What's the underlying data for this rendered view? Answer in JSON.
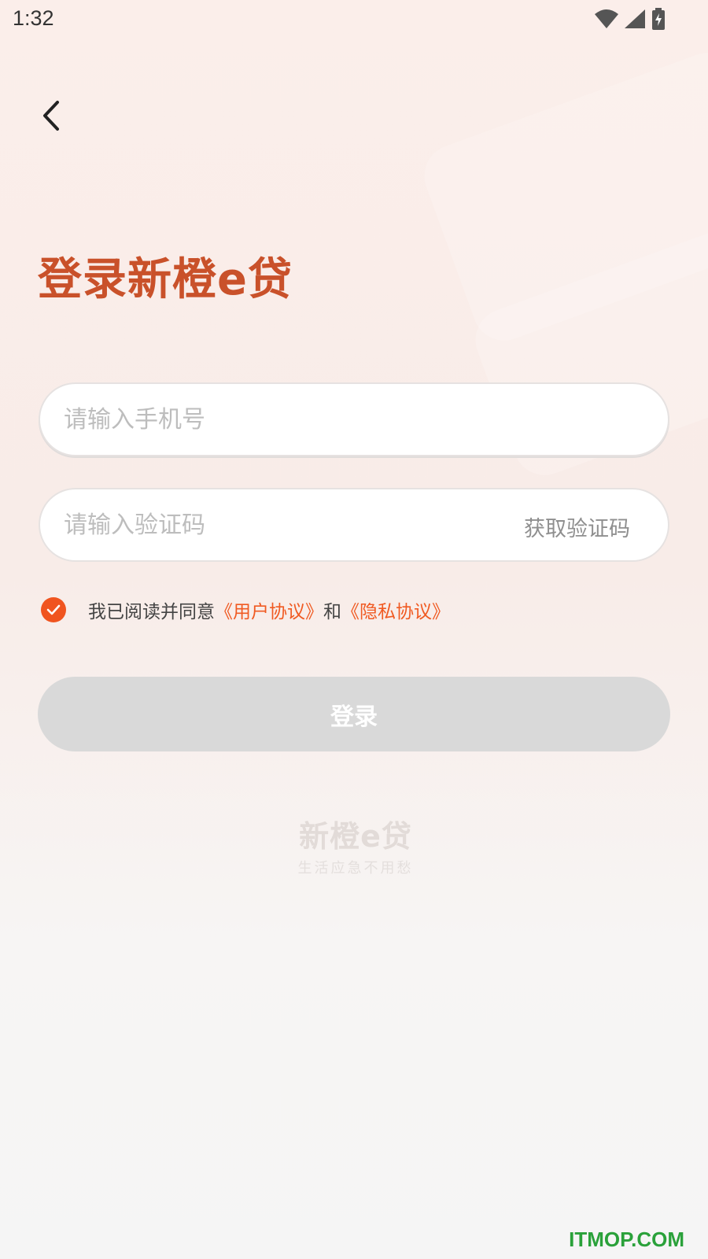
{
  "status_bar": {
    "time": "1:32",
    "icons": [
      "wifi-icon",
      "signal-icon",
      "battery-charging-icon"
    ]
  },
  "nav": {
    "back_icon": "chevron-left-icon"
  },
  "page_title": "登录新橙e贷",
  "form": {
    "phone": {
      "value": "",
      "placeholder": "请输入手机号"
    },
    "code": {
      "value": "",
      "placeholder": "请输入验证码",
      "get_code_label": "获取验证码"
    },
    "agreement": {
      "checked": true,
      "prefix": "我已阅读并同意",
      "user_agreement": "《用户协议》",
      "conjunction": "和",
      "privacy_agreement": "《隐私协议》"
    },
    "login_label": "登录"
  },
  "brand": {
    "name": "新橙e贷",
    "slogan": "生活应急不用愁"
  },
  "watermark": "ITMOP.COM",
  "colors": {
    "accent": "#f05a22",
    "title": "#c9512a",
    "disabled_button": "#d9d9d9",
    "watermark": "#2aa13a"
  }
}
